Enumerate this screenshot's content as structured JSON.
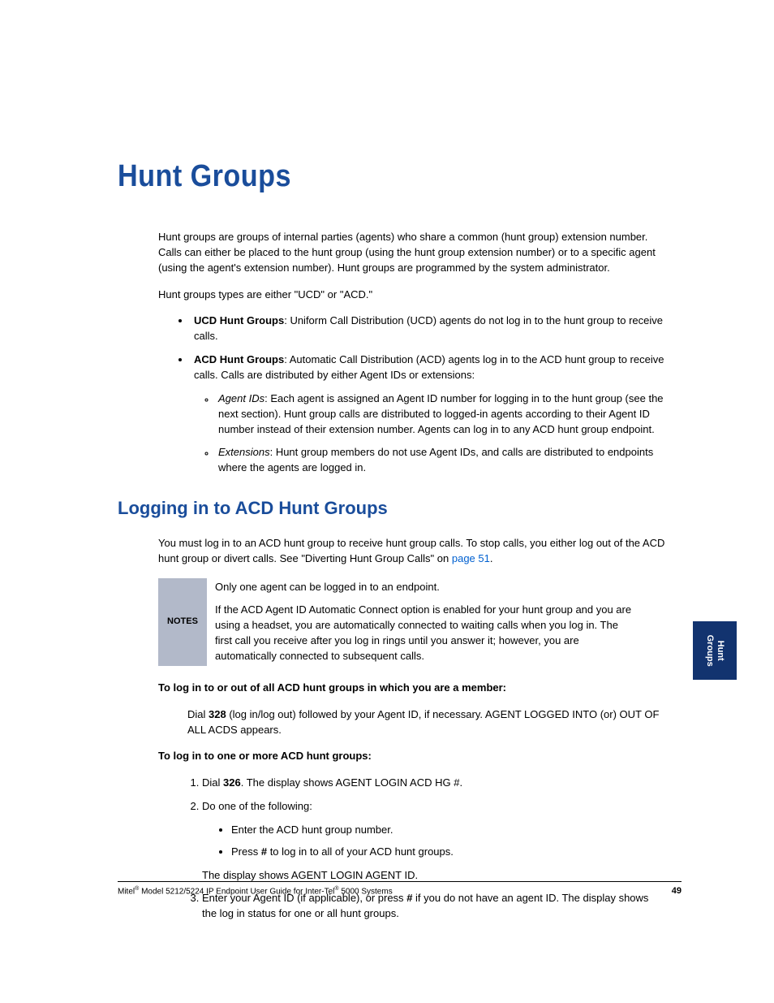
{
  "chapter_title": "Hunt Groups",
  "intro_p1": "Hunt groups are groups of internal parties (agents) who share a common (hunt group) extension number. Calls can either be placed to the hunt group (using the hunt group extension number) or to a specific agent (using the agent's extension number). Hunt groups are programmed by the system administrator.",
  "intro_p2": "Hunt groups types are either \"UCD\" or \"ACD.\"",
  "bul1_bold": "UCD Hunt Groups",
  "bul1_rest": ": Uniform Call Distribution (UCD) agents do not log in to the hunt group to receive calls.",
  "bul2_bold": "ACD Hunt Groups",
  "bul2_rest": ": Automatic Call Distribution (ACD) agents log in to the ACD hunt group to receive calls. Calls are distributed by either Agent IDs or extensions:",
  "sub1_it": "Agent IDs",
  "sub1_rest": ": Each agent is assigned an Agent ID number for logging in to the hunt group (see the next section). Hunt group calls are distributed to logged-in agents according to their Agent ID number instead of their extension number. Agents can log in to any ACD hunt group endpoint.",
  "sub2_it": "Extensions",
  "sub2_rest": ": Hunt group members do not use Agent IDs, and calls are distributed to endpoints where the agents are logged in.",
  "section_heading": "Logging in to ACD Hunt Groups",
  "sec_p1a": "You must log in to an ACD hunt group to receive hunt group calls. To stop calls, you either log out of the ACD hunt group or divert calls. See \"Diverting Hunt Group Calls\" on ",
  "sec_p1_link": "page 51",
  "sec_p1b": ".",
  "notes_label": "NOTES",
  "notes_p1": "Only one agent can be logged in to an endpoint.",
  "notes_p2": "If the ACD Agent ID Automatic Connect option is enabled for your hunt group and you are using a headset, you are automatically connected to waiting calls when you log in. The first call you receive after you log in rings until you answer it; however, you are automatically connected to subsequent calls.",
  "instr1_head": "To log in to or out of all ACD hunt groups in which you are a member:",
  "instr1_body_a": "Dial ",
  "instr1_body_bold": "328",
  "instr1_body_b": " (log in/log out) followed by your Agent ID, if necessary. AGENT LOGGED INTO (or) OUT OF ALL ACDS appears.",
  "instr2_head": "To log in to one or more ACD hunt groups:",
  "step1_a": "Dial ",
  "step1_bold": "326",
  "step1_b": ". The display shows AGENT LOGIN ACD HG #.",
  "step2": "Do one of the following:",
  "step2_b1": "Enter the ACD hunt group number.",
  "step2_b2a": "Press ",
  "step2_b2bold": "#",
  "step2_b2b": " to log in to all of your ACD hunt groups.",
  "step2_after": "The display shows AGENT LOGIN AGENT ID.",
  "step3_a": "Enter your Agent ID (if applicable), or press ",
  "step3_bold": "#",
  "step3_b": " if you do not have an agent ID. The display shows the log in status for one or all hunt groups.",
  "side_tab_l1": "Hunt",
  "side_tab_l2": "Groups",
  "footer_left_1": "Mitel",
  "footer_left_2": " Model 5212/5224 IP Endpoint User Guide for Inter-Tel",
  "footer_left_3": " 5000 Systems",
  "footer_page": "49"
}
